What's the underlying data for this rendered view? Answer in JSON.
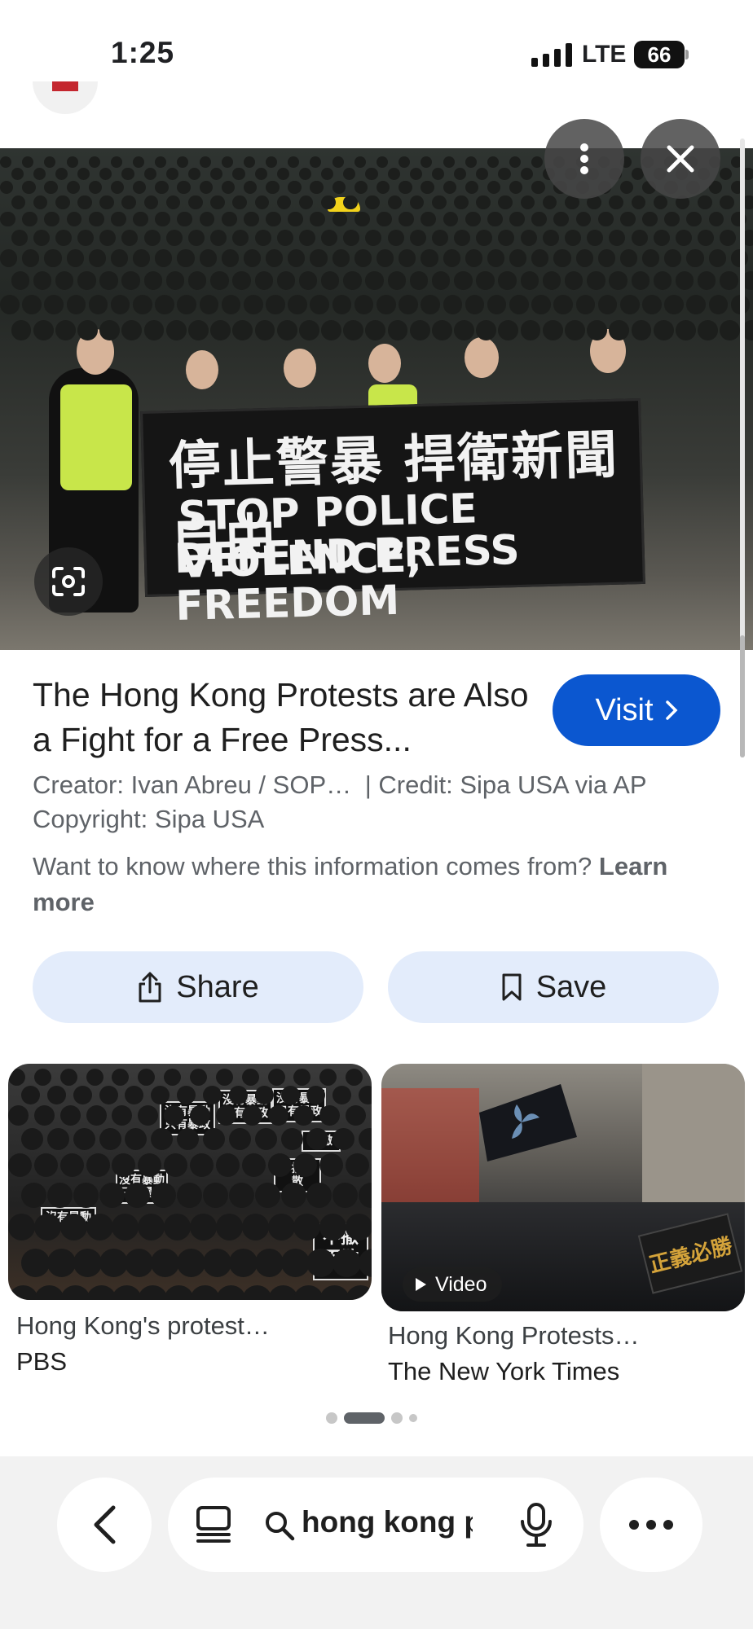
{
  "status_bar": {
    "time": "1:25",
    "network": "LTE",
    "battery": "66"
  },
  "hero": {
    "banner_line1": "停止警暴 捍衛新聞自由",
    "banner_line2": "STOP POLICE VIOLENCE,",
    "banner_line3": "DEFEND PRESS FREEDOM"
  },
  "result": {
    "title": "The Hong Kong Protests are Also a Fight for a Free Press...",
    "visit_label": "Visit",
    "creator": "Creator: Ivan Abreu / SOP…",
    "credit": "| Credit: Sipa USA via AP",
    "copyright": "Copyright: Sipa USA",
    "info_text": "Want to know where this information comes from?",
    "learn_more": "Learn more"
  },
  "actions": {
    "share_label": "Share",
    "save_label": "Save"
  },
  "related": [
    {
      "title": "Hong Kong's protest…",
      "source": "PBS",
      "signs": [
        "沒有暴動 只有暴政",
        "沒有暴動 只有暴政",
        "沒有暴動 只有暴政",
        "沒有暴動",
        "不撤不散",
        "不撤",
        "沒有暴動 只有暴政",
        "不撤不散"
      ]
    },
    {
      "title": "Hong Kong Protests…",
      "source": "The New York Times",
      "badge": "Video",
      "sign_text": "正義必勝"
    }
  ],
  "toolbar": {
    "query": "hong kong pr"
  },
  "colors": {
    "accent": "#0b57d0",
    "pill_bg": "#e3ecfb"
  }
}
